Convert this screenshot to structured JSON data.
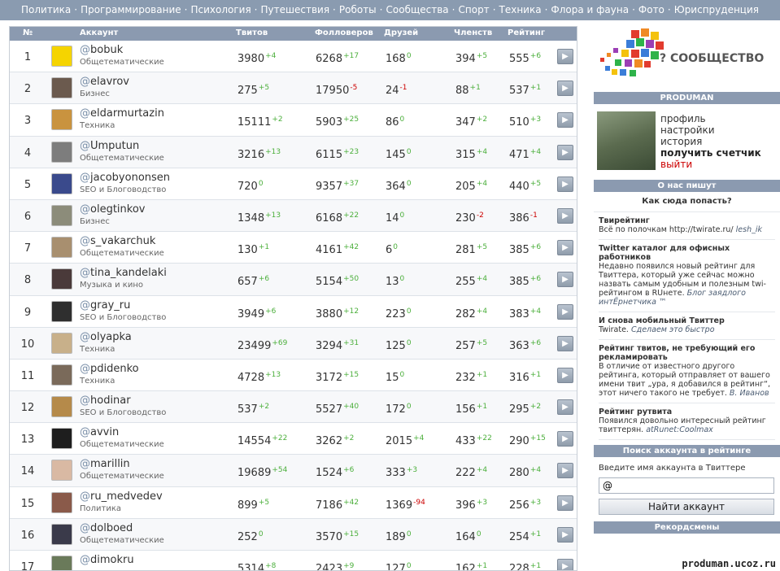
{
  "nav": [
    "Политика",
    "Программирование",
    "Психология",
    "Путешествия",
    "Роботы",
    "Сообщества",
    "Спорт",
    "Техника",
    "Флора и фауна",
    "Фото",
    "Юриспруденция"
  ],
  "nav_sep": "·",
  "table": {
    "headers": {
      "num": "№",
      "account": "Аккаунт",
      "tweets": "Твитов",
      "followers": "Фолловеров",
      "friends": "Друзей",
      "lists": "Членств",
      "rating": "Рейтинг"
    },
    "at": "@",
    "go_icon": "arrow-right",
    "rows": [
      {
        "n": "1",
        "name": "bobuk",
        "cat": "Общетематические",
        "tw": "3980",
        "twd": "+4",
        "fo": "6268",
        "fod": "+17",
        "fr": "168",
        "frd": "0",
        "li": "394",
        "lid": "+5",
        "ra": "555",
        "rad": "+6",
        "av": "#f5d400"
      },
      {
        "n": "2",
        "name": "elavrov",
        "cat": "Бизнес",
        "tw": "275",
        "twd": "+5",
        "fo": "17950",
        "fod": "-5",
        "fr": "24",
        "frd": "-1",
        "li": "88",
        "lid": "+1",
        "ra": "537",
        "rad": "+1",
        "av": "#6b5a4e"
      },
      {
        "n": "3",
        "name": "eldarmurtazin",
        "cat": "Техника",
        "tw": "15111",
        "twd": "+2",
        "fo": "5903",
        "fod": "+25",
        "fr": "86",
        "frd": "0",
        "li": "347",
        "lid": "+2",
        "ra": "510",
        "rad": "+3",
        "av": "#c9933f"
      },
      {
        "n": "4",
        "name": "Umputun",
        "cat": "Общетематические",
        "tw": "3216",
        "twd": "+13",
        "fo": "6115",
        "fod": "+23",
        "fr": "145",
        "frd": "0",
        "li": "315",
        "lid": "+4",
        "ra": "471",
        "rad": "+4",
        "av": "#7d7d7d"
      },
      {
        "n": "5",
        "name": "jacobyononsen",
        "cat": "SEO и Блоговодство",
        "tw": "720",
        "twd": "0",
        "fo": "9357",
        "fod": "+37",
        "fr": "364",
        "frd": "0",
        "li": "205",
        "lid": "+4",
        "ra": "440",
        "rad": "+5",
        "av": "#3a4a8c"
      },
      {
        "n": "6",
        "name": "olegtinkov",
        "cat": "Бизнес",
        "tw": "1348",
        "twd": "+13",
        "fo": "6168",
        "fod": "+22",
        "fr": "14",
        "frd": "0",
        "li": "230",
        "lid": "-2",
        "ra": "386",
        "rad": "-1",
        "av": "#8c8c7a"
      },
      {
        "n": "7",
        "name": "s_vakarchuk",
        "cat": "Общетематические",
        "tw": "130",
        "twd": "+1",
        "fo": "4161",
        "fod": "+42",
        "fr": "6",
        "frd": "0",
        "li": "281",
        "lid": "+5",
        "ra": "385",
        "rad": "+6",
        "av": "#a88f6f"
      },
      {
        "n": "8",
        "name": "tina_kandelaki",
        "cat": "Музыка и кино",
        "tw": "657",
        "twd": "+6",
        "fo": "5154",
        "fod": "+50",
        "fr": "13",
        "frd": "0",
        "li": "255",
        "lid": "+4",
        "ra": "385",
        "rad": "+6",
        "av": "#4a3a3a"
      },
      {
        "n": "9",
        "name": "gray_ru",
        "cat": "SEO и Блоговодство",
        "tw": "3949",
        "twd": "+6",
        "fo": "3880",
        "fod": "+12",
        "fr": "223",
        "frd": "0",
        "li": "282",
        "lid": "+4",
        "ra": "383",
        "rad": "+4",
        "av": "#2f2f2f"
      },
      {
        "n": "10",
        "name": "olyapka",
        "cat": "Техника",
        "tw": "23499",
        "twd": "+69",
        "fo": "3294",
        "fod": "+31",
        "fr": "125",
        "frd": "0",
        "li": "257",
        "lid": "+5",
        "ra": "363",
        "rad": "+6",
        "av": "#c8b08a"
      },
      {
        "n": "11",
        "name": "pdidenko",
        "cat": "Техника",
        "tw": "4728",
        "twd": "+13",
        "fo": "3172",
        "fod": "+15",
        "fr": "15",
        "frd": "0",
        "li": "232",
        "lid": "+1",
        "ra": "316",
        "rad": "+1",
        "av": "#7a6a5a"
      },
      {
        "n": "12",
        "name": "hodinar",
        "cat": "SEO и Блоговодство",
        "tw": "537",
        "twd": "+2",
        "fo": "5527",
        "fod": "+40",
        "fr": "172",
        "frd": "0",
        "li": "156",
        "lid": "+1",
        "ra": "295",
        "rad": "+2",
        "av": "#b58a4a"
      },
      {
        "n": "13",
        "name": "avvin",
        "cat": "Общетематические",
        "tw": "14554",
        "twd": "+22",
        "fo": "3262",
        "fod": "+2",
        "fr": "2015",
        "frd": "+4",
        "li": "433",
        "lid": "+22",
        "ra": "290",
        "rad": "+15",
        "av": "#1e1e1e"
      },
      {
        "n": "14",
        "name": "marillin",
        "cat": "Общетематические",
        "tw": "19689",
        "twd": "+54",
        "fo": "1524",
        "fod": "+6",
        "fr": "333",
        "frd": "+3",
        "li": "222",
        "lid": "+4",
        "ra": "280",
        "rad": "+4",
        "av": "#d9b9a3"
      },
      {
        "n": "15",
        "name": "ru_medvedev",
        "cat": "Политика",
        "tw": "899",
        "twd": "+5",
        "fo": "7186",
        "fod": "+42",
        "fr": "1369",
        "frd": "-94",
        "li": "396",
        "lid": "+3",
        "ra": "256",
        "rad": "+3",
        "av": "#8a5a4a"
      },
      {
        "n": "16",
        "name": "dolboed",
        "cat": "Общетематические",
        "tw": "252",
        "twd": "0",
        "fo": "3570",
        "fod": "+15",
        "fr": "189",
        "frd": "0",
        "li": "164",
        "lid": "0",
        "ra": "254",
        "rad": "+1",
        "av": "#3a3a4a"
      },
      {
        "n": "17",
        "name": "dimokru",
        "cat": "",
        "tw": "5314",
        "twd": "+8",
        "fo": "2423",
        "fod": "+9",
        "fr": "127",
        "frd": "0",
        "li": "162",
        "lid": "+1",
        "ra": "228",
        "rad": "+1",
        "av": "#6a7a5a"
      }
    ]
  },
  "side": {
    "logo_text": "? СООБЩЕСТВО",
    "user_header": "PRODUMAN",
    "links": {
      "profile": "профиль",
      "settings": "настройки",
      "history": "история",
      "counter": "получить счетчик",
      "logout": "выйти"
    },
    "about_header": "О нас пишут",
    "how": "Как сюда попасть?",
    "news": [
      {
        "title": "Твирейтинг",
        "body": "Всё по полочкам http://twirate.ru/",
        "src": "lesh_ik"
      },
      {
        "title": "Twitter каталог для офисных работников",
        "body": "Недавно появился новый рейтинг для Твиттера, который уже сейчас можно назвать самым удобным и полезным twi-рейтингом в RUнете.",
        "src": "Блог заядлого интЁрнетчика ™"
      },
      {
        "title": "И снова мобильный Твиттер",
        "body": "Twirate.",
        "src": "Сделаем это быстро"
      },
      {
        "title": "Рейтинг твитов, не требующий его рекламировать",
        "body": "В отличие от известного другого рейтинга, который отправляет от вашего имени твит „ура, я добавился в рейтинг“, этот ничего такого не требует.",
        "src": "В. Иванов"
      },
      {
        "title": "Рейтинг рутвита",
        "body": "Появился довольно интересный рейтинг твиттерян.",
        "src": "atRunet:Coolmax"
      }
    ],
    "search_header": "Поиск аккаунта в рейтинге",
    "search_label": "Введите имя аккаунта в Твиттере",
    "search_value": "@",
    "search_button": "Найти аккаунт",
    "record_header": "Рекордсмены"
  },
  "watermark": "produman.ucoz.ru"
}
